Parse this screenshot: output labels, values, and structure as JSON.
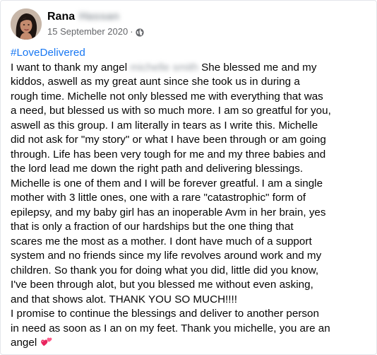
{
  "post": {
    "author": {
      "first_name": "Rana",
      "last_name_redacted": "Hassan"
    },
    "date": "15 September 2020",
    "separator": "·",
    "privacy_icon": "globe-icon",
    "hashtag": "#LoveDelivered",
    "redacted_name": "michelle smith",
    "lines": {
      "l1a": " I want to thank my angel ",
      "l1b": " She blessed me and my",
      "l2": "kiddos, aswell as my  great aunt since she took us in during a",
      "l3": "rough time. Michelle not only blessed me with everything that was",
      "l4": "a need, but blessed us with so much more. I am so greatful for you,",
      "l5": "aswell as this group. I am literally in tears as I write this. Michelle",
      "l6": "did not ask for \"my story\" or what I have been through or am going",
      "l7": "through. Life has been very tough for me and my three babies and",
      "l8": "the lord lead me down the right path and delivering blessings.",
      "l9": "Michelle is one of them and I will be forever greatful. I am a single",
      "l10": "mother with 3 little ones, one with a rare \"catastrophic\" form of",
      "l11": "epilepsy, and my baby girl has an inoperable Avm in her brain, yes",
      "l12": "that is only a fraction of our hardships but the one thing that",
      "l13": "scares me the most as a mother. I dont have much of a support",
      "l14": "system and no friends since my life revolves around work and my",
      "l15": "children. So thank you for doing what you did, little did you know,",
      "l16": "I've been through alot, but you blessed me without even asking,",
      "l17": "and that shows alot. THANK YOU SO MUCH!!!!",
      "l18": "   I promise to continue the blessings and deliver to another person",
      "l19": "in need as soon as I an on my feet. Thank you michelle, you are an",
      "l20": "angel "
    },
    "end_icon": "two-hearts-icon",
    "colors": {
      "hashtag": "#1877f2",
      "text": "#050505",
      "meta": "#65676b",
      "heart": "#e8245e"
    }
  }
}
